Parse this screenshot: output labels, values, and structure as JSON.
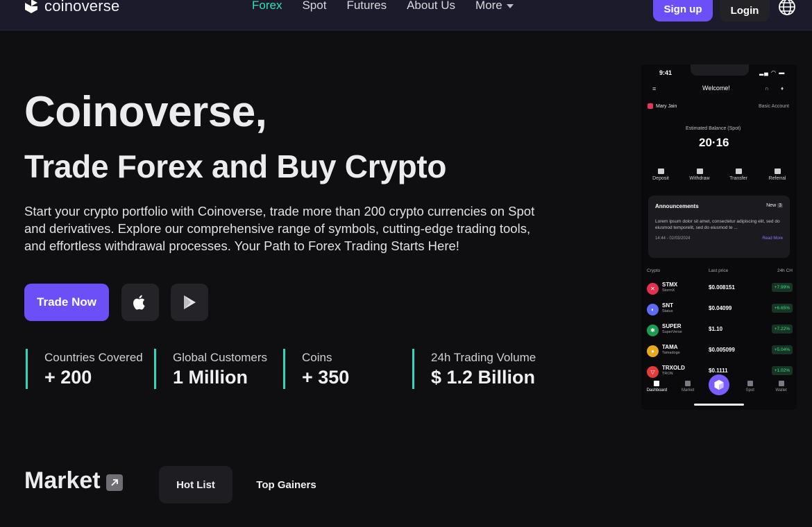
{
  "brand": {
    "name": "coinoverse"
  },
  "nav": {
    "links": [
      {
        "label": "Forex",
        "active": true
      },
      {
        "label": "Spot"
      },
      {
        "label": "Futures"
      },
      {
        "label": "About Us"
      },
      {
        "label": "More"
      }
    ],
    "signup": "Sign up",
    "login": "Login",
    "language_icon": "globe-icon"
  },
  "hero": {
    "title": "Coinoverse,",
    "subtitle": "Trade Forex and Buy Crypto",
    "description": "Start your crypto portfolio with Coinoverse, trade more than 200 crypto currencies on Spot and derivatives. Explore our comprehensive range of symbols, cutting-edge trading tools, and effortless withdrawal processes. Your Path to Forex Trading Starts Here!",
    "cta": "Trade Now",
    "store_icons": [
      "apple-icon",
      "google-play-icon"
    ]
  },
  "stats": [
    {
      "label": "Countries Covered",
      "value": "+ 200"
    },
    {
      "label": "Global Customers",
      "value": "1 Million"
    },
    {
      "label": "Coins",
      "value": "+ 350"
    },
    {
      "label": "24h Trading Volume",
      "value": "$ 1.2 Billion"
    }
  ],
  "market": {
    "title": "Market",
    "tabs": [
      {
        "label": "Hot List",
        "active": true
      },
      {
        "label": "Top Gainers"
      }
    ]
  },
  "phone": {
    "time": "9:41",
    "welcome": "Welcome!",
    "user": "Mary Jain",
    "account_type": "Basic Account",
    "balance_label": "Estimated Balance (Spot)",
    "balance": "20·16",
    "actions": [
      "Deposit",
      "Withdraw",
      "Transfer",
      "Referral"
    ],
    "announcements": {
      "title": "Announcements",
      "new_label": "New",
      "new_count": "3",
      "body": "Lorem ipsum dolor sit amet, consectetur adipiscing elit, sed do eiusmod temporelit, sed do eiusmod te ...",
      "date": "14:44 - 02/03/2024",
      "read_more": "Read More"
    },
    "table_headers": [
      "Crypto",
      "Last price",
      "24h CH"
    ],
    "rows": [
      {
        "symbol": "STMX",
        "name": "StormX",
        "price": "$0.008151",
        "change": "+7.99%",
        "color": "#e5304e",
        "glyph": "✕"
      },
      {
        "symbol": "SNT",
        "name": "Status",
        "price": "$0.04099",
        "change": "+6.65%",
        "color": "#5b6cf2",
        "glyph": "◐"
      },
      {
        "symbol": "SUPER",
        "name": "SuperVerse",
        "price": "$1.10",
        "change": "+7.22%",
        "color": "#1c9c52",
        "glyph": "✱"
      },
      {
        "symbol": "TAMA",
        "name": "Tamadoge",
        "price": "$0.005099",
        "change": "+5.04%",
        "color": "#e8a91c",
        "glyph": "●"
      },
      {
        "symbol": "TRXOLD",
        "name": "TRON",
        "price": "$0.1111",
        "change": "+1.02%",
        "color": "#e33a3a",
        "glyph": "▽"
      }
    ],
    "tabs": [
      "Dashboard",
      "Market",
      "",
      "Spot",
      "Wallet"
    ]
  }
}
